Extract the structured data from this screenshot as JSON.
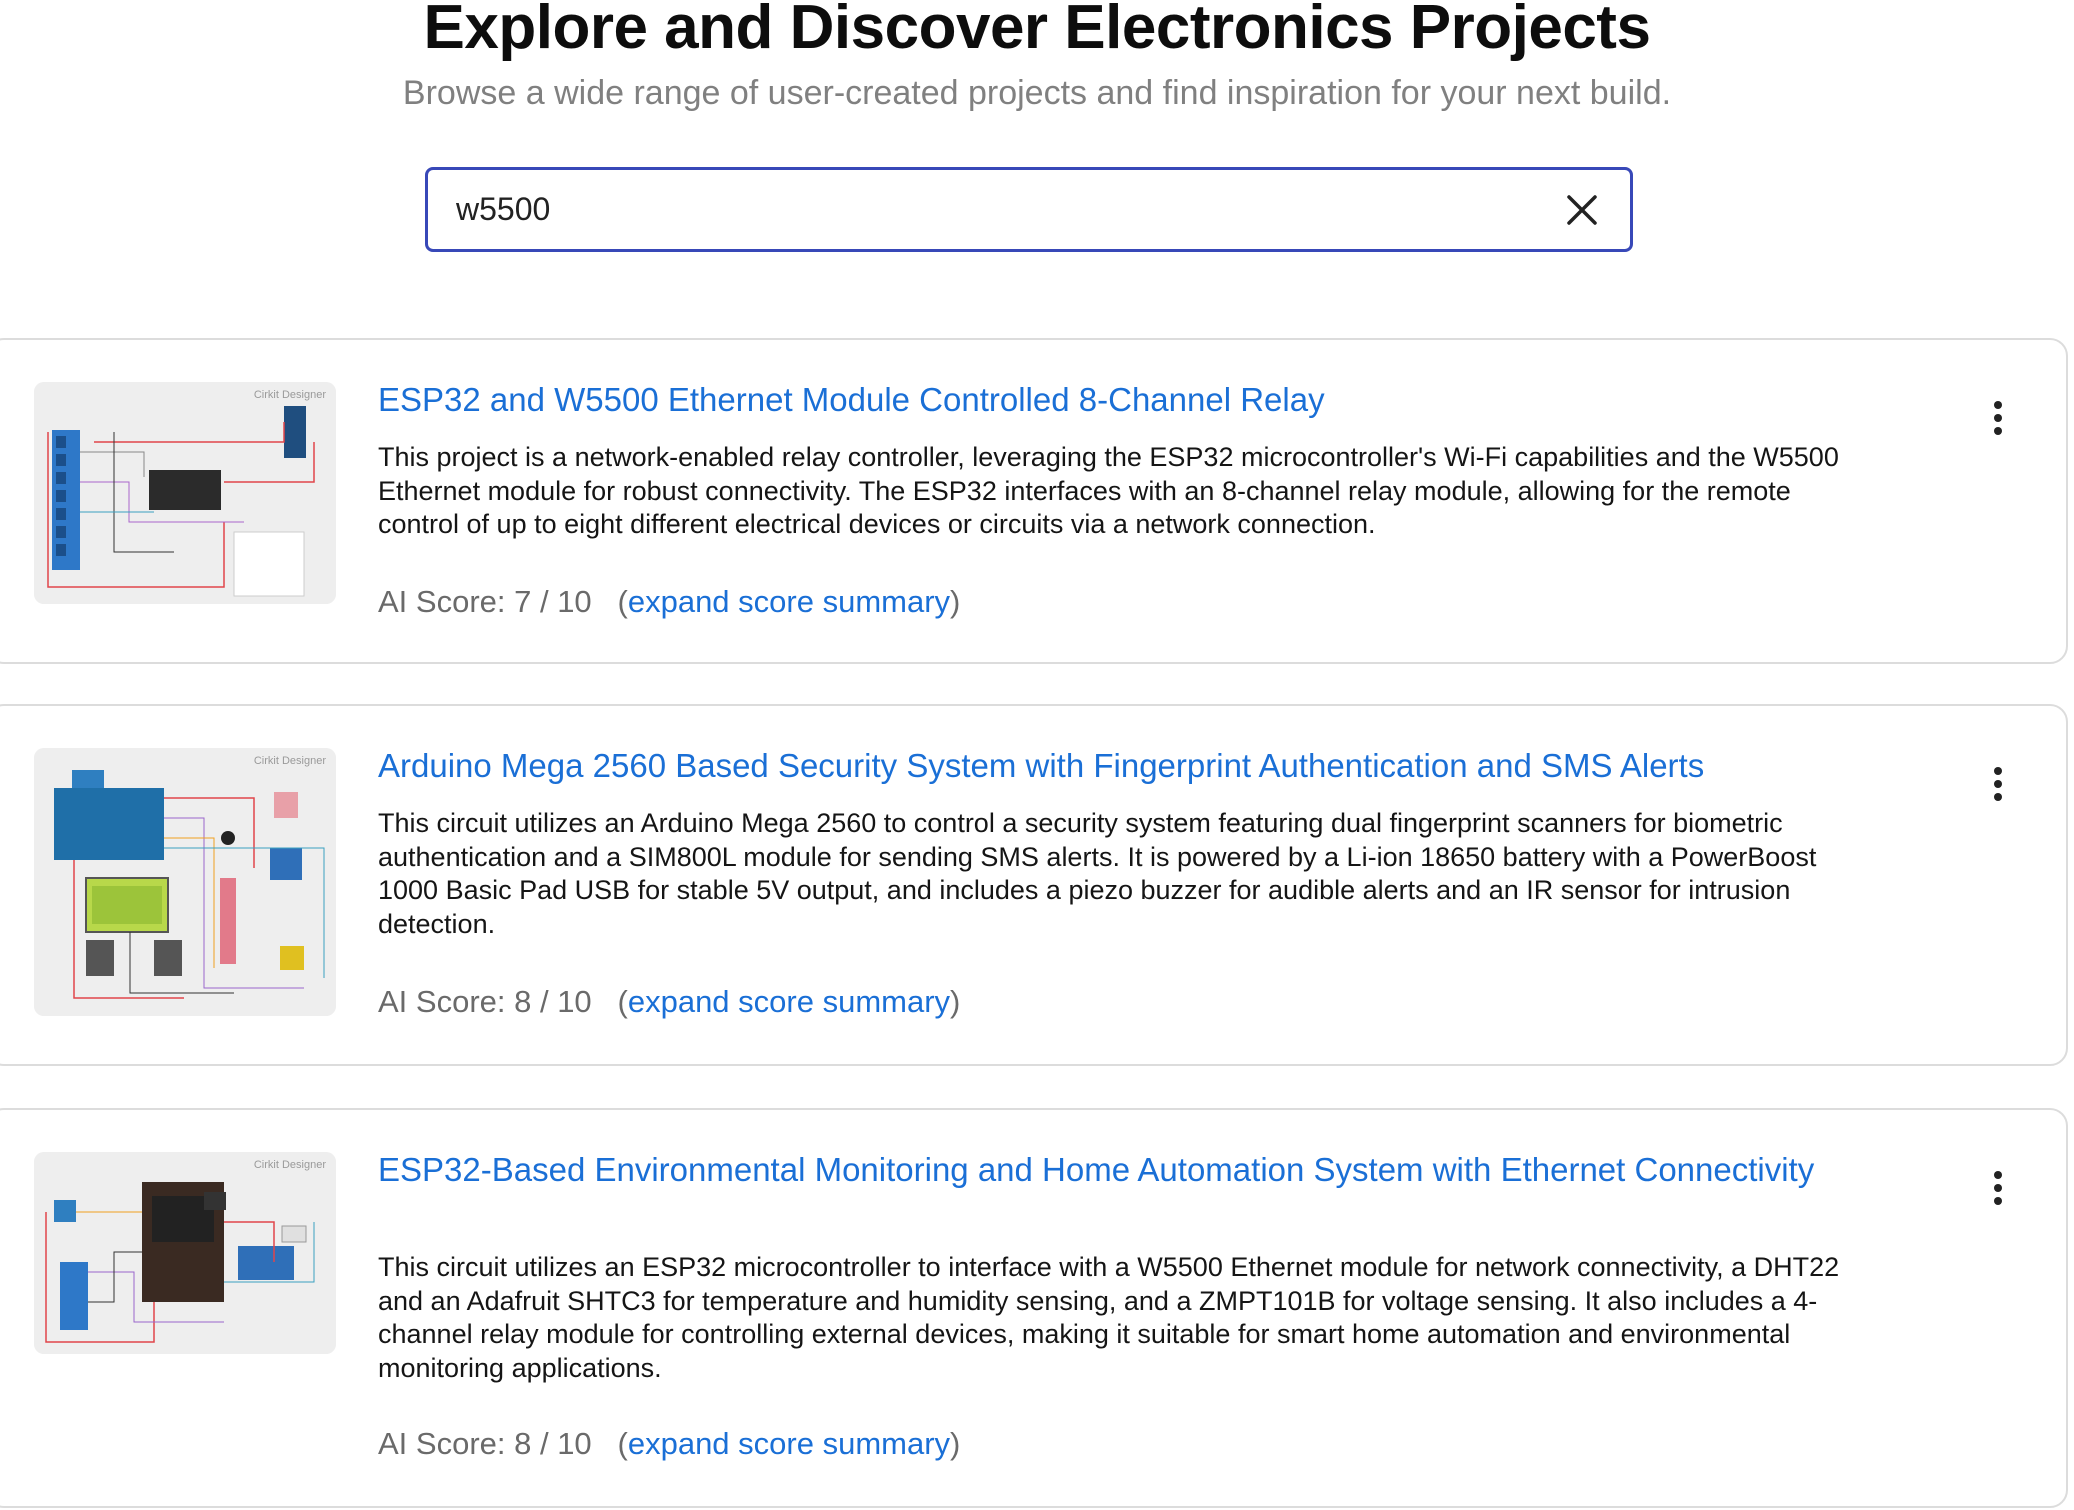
{
  "header": {
    "title": "Explore and Discover Electronics Projects",
    "subtitle": "Browse a wide range of user-created projects and find inspiration for your next build."
  },
  "search": {
    "value": "w5500",
    "clear_icon": "close-icon"
  },
  "projects": [
    {
      "title": "ESP32 and W5500 Ethernet Module Controlled 8-Channel Relay",
      "description": "This project is a network-enabled relay controller, leveraging the ESP32 microcontroller's Wi-Fi capabilities and the W5500 Ethernet module for robust connectivity. The ESP32 interfaces with an 8-channel relay module, allowing for the remote control of up to eight different electrical devices or circuits via a network connection.",
      "score_label": "AI Score: 7 / 10",
      "expand_open": "(",
      "expand_label": "expand score summary",
      "expand_close": ")",
      "thumbnail_watermark": "Cirkit Designer",
      "menu_icon": "more-vertical-icon"
    },
    {
      "title": "Arduino Mega 2560 Based Security System with Fingerprint Authentication and SMS Alerts",
      "description": "This circuit utilizes an Arduino Mega 2560 to control a security system featuring dual fingerprint scanners for biometric authentication and a SIM800L module for sending SMS alerts. It is powered by a Li-ion 18650 battery with a PowerBoost 1000 Basic Pad USB for stable 5V output, and includes a piezo buzzer for audible alerts and an IR sensor for intrusion detection.",
      "score_label": "AI Score: 8 / 10",
      "expand_open": "(",
      "expand_label": "expand score summary",
      "expand_close": ")",
      "thumbnail_watermark": "Cirkit Designer",
      "menu_icon": "more-vertical-icon"
    },
    {
      "title": "ESP32-Based Environmental Monitoring and Home Automation System with Ethernet Connectivity",
      "description": "This circuit utilizes an ESP32 microcontroller to interface with a W5500 Ethernet module for network connectivity, a DHT22 and an Adafruit SHTC3 for temperature and humidity sensing, and a ZMPT101B for voltage sensing. It also includes a 4-channel relay module for controlling external devices, making it suitable for smart home automation and environmental monitoring applications.",
      "score_label": "AI Score: 8 / 10",
      "expand_open": "(",
      "expand_label": "expand score summary",
      "expand_close": ")",
      "thumbnail_watermark": "Cirkit Designer",
      "menu_icon": "more-vertical-icon"
    }
  ],
  "colors": {
    "link": "#1a6fd6",
    "search_border": "#3848b8",
    "card_border": "#dcdcdc"
  }
}
